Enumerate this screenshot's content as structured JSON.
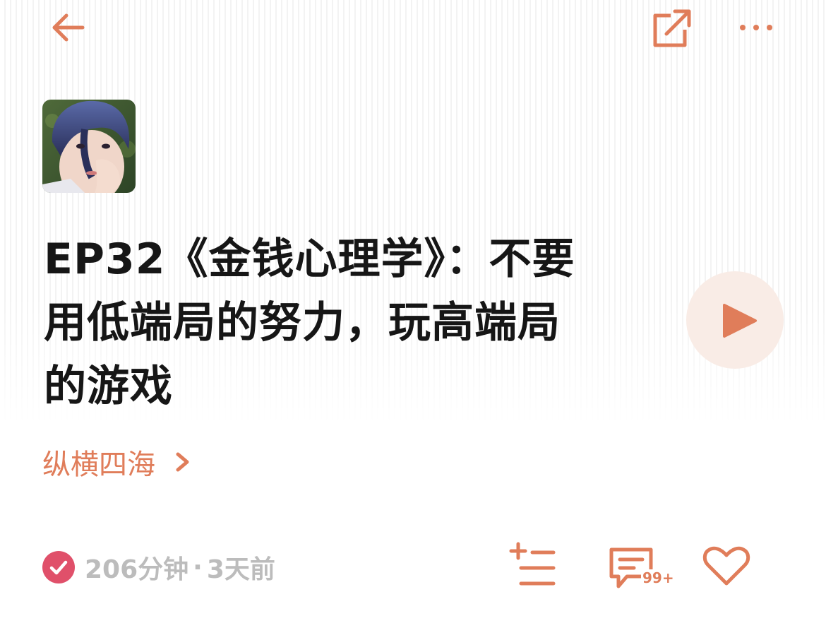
{
  "header": {
    "back_icon": "arrow-left-icon",
    "share_icon": "share-external-icon",
    "more_icon": "more-dots-icon"
  },
  "episode": {
    "title": "EP32《金钱心理学》：不要用低端局的努力，玩高端局的游戏",
    "channel": "纵横四海",
    "duration": "206分钟",
    "separator": "·",
    "published": "3天前"
  },
  "actions": {
    "comment_count": "99+"
  },
  "colors": {
    "accent": "#e07d5a",
    "play_bg": "#f9ece6",
    "check": "#e0506a",
    "meta_text": "#bcbcbc",
    "title_text": "#161616"
  }
}
